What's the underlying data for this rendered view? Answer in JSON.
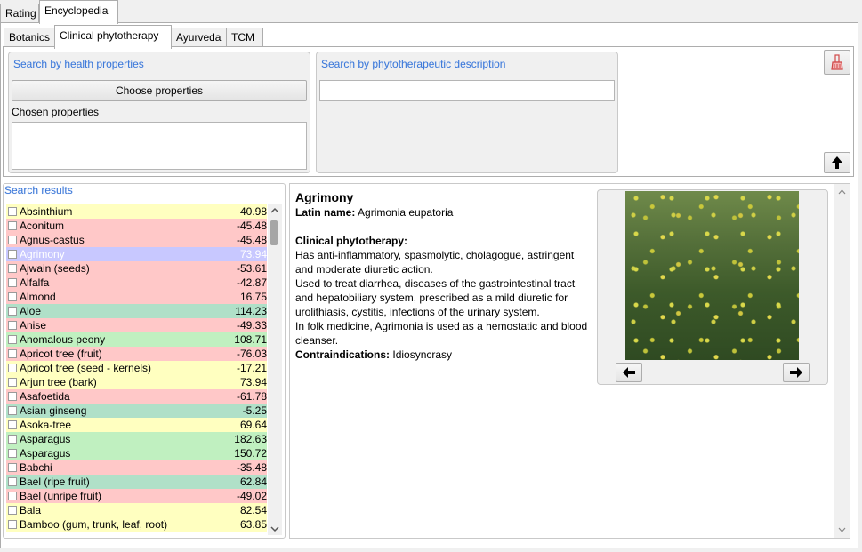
{
  "top_tabs": [
    "Rating",
    "Encyclopedia"
  ],
  "sub_tabs": [
    "Botanics",
    "Clinical phytotherapy",
    "Ayurveda",
    "TCM"
  ],
  "health_search": {
    "title": "Search by health properties",
    "choose_button": "Choose properties",
    "chosen_label": "Chosen properties"
  },
  "desc_search": {
    "title": "Search by phytotherapeutic description",
    "value": ""
  },
  "icons": {
    "clear": "eraser-icon",
    "up": "arrow-up-icon",
    "prev": "arrow-left-icon",
    "next": "arrow-right-icon"
  },
  "results": {
    "title": "Search results",
    "colors": {
      "yellow": "#ffffc0",
      "red": "#ffc8c8",
      "green": "#c0f0c0",
      "teal": "#b0e0c8",
      "selected": "#c8c8ff"
    },
    "rows": [
      {
        "name": "Absinthium",
        "value": "40.98",
        "color": "yellow"
      },
      {
        "name": "Aconitum",
        "value": "-45.48",
        "color": "red"
      },
      {
        "name": "Agnus-castus",
        "value": "-45.48",
        "color": "red"
      },
      {
        "name": "Agrimony",
        "value": "73.94",
        "color": "selected"
      },
      {
        "name": "Ajwain (seeds)",
        "value": "-53.61",
        "color": "red"
      },
      {
        "name": "Alfalfa",
        "value": "-42.87",
        "color": "red"
      },
      {
        "name": "Almond",
        "value": "16.75",
        "color": "red"
      },
      {
        "name": "Aloe",
        "value": "114.23",
        "color": "teal"
      },
      {
        "name": "Anise",
        "value": "-49.33",
        "color": "red"
      },
      {
        "name": "Anomalous peony",
        "value": "108.71",
        "color": "green"
      },
      {
        "name": "Apricot tree (fruit)",
        "value": "-76.03",
        "color": "red"
      },
      {
        "name": "Apricot tree (seed - kernels)",
        "value": "-17.21",
        "color": "yellow"
      },
      {
        "name": "Arjun tree (bark)",
        "value": "73.94",
        "color": "yellow"
      },
      {
        "name": "Asafoetida",
        "value": "-61.78",
        "color": "red"
      },
      {
        "name": "Asian ginseng",
        "value": "-5.25",
        "color": "teal"
      },
      {
        "name": "Asoka-tree",
        "value": "69.64",
        "color": "yellow"
      },
      {
        "name": "Asparagus",
        "value": "182.63",
        "color": "green"
      },
      {
        "name": "Asparagus",
        "value": "150.72",
        "color": "green"
      },
      {
        "name": "Babchi",
        "value": "-35.48",
        "color": "red"
      },
      {
        "name": "Bael (ripe fruit)",
        "value": "62.84",
        "color": "teal"
      },
      {
        "name": "Bael (unripe fruit)",
        "value": "-49.02",
        "color": "red"
      },
      {
        "name": "Bala",
        "value": "82.54",
        "color": "yellow"
      },
      {
        "name": "Bamboo (gum, trunk, leaf, root)",
        "value": "63.85",
        "color": "yellow"
      }
    ]
  },
  "detail": {
    "name": "Agrimony",
    "latin_label": "Latin name:",
    "latin_value": "Agrimonia eupatoria",
    "section_title": "Clinical phytotherapy:",
    "para1": "Has anti-inflammatory, spasmolytic, cholagogue, astringent and moderate diuretic action.",
    "para2": "Used to treat diarrhea, diseases of the gastrointestinal tract and hepatobiliary system, prescribed as a mild diuretic for urolithiasis, cystitis, infections of the urinary system.",
    "para3": "In folk medicine, Agrimonia is used as a hemostatic and blood cleanser.",
    "contra_label": "Contraindications:",
    "contra_value": "Idiosyncrasy"
  }
}
